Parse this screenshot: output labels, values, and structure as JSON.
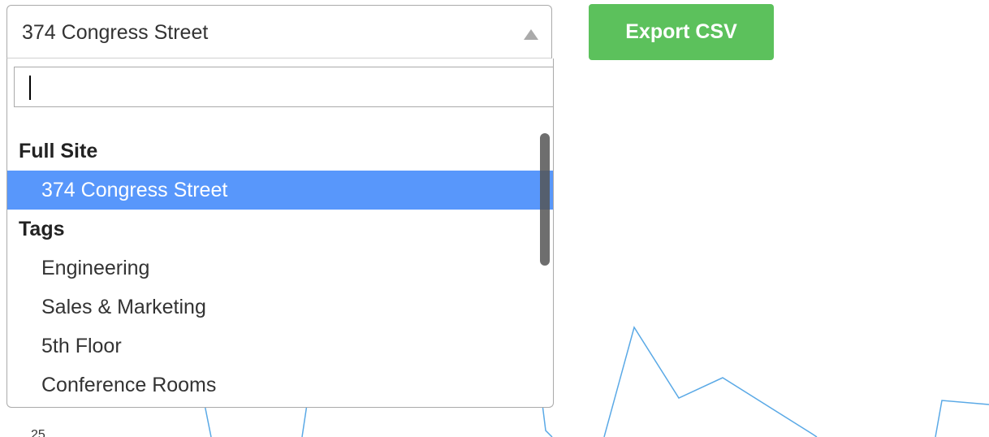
{
  "select": {
    "value": "374 Congress Street",
    "search_value": ""
  },
  "options": {
    "groups": [
      {
        "label": "Full Site",
        "items": [
          {
            "label": "374 Congress Street",
            "selected": true
          }
        ]
      },
      {
        "label": "Tags",
        "items": [
          {
            "label": "Engineering"
          },
          {
            "label": "Sales & Marketing"
          },
          {
            "label": "5th Floor"
          },
          {
            "label": "Conference Rooms"
          }
        ]
      }
    ]
  },
  "toolbar": {
    "export_label": "Export CSV"
  },
  "chart": {
    "y_tick_partial": "25",
    "line_color": "#5aa9e6"
  },
  "colors": {
    "selected_bg": "#5897fb",
    "export_bg": "#5cc15c"
  }
}
